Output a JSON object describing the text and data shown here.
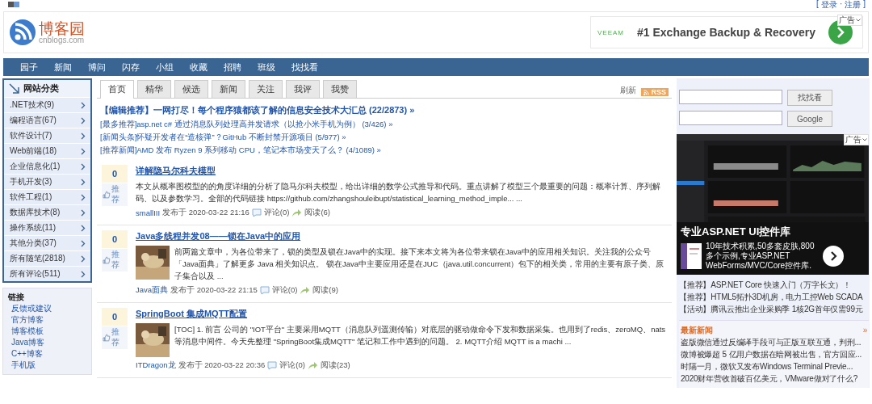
{
  "top_bar": {
    "open": "[",
    "links": [
      "登录",
      "注册"
    ],
    "separator": "·",
    "close": "]"
  },
  "header": {
    "logo": {
      "name": "博客园",
      "domain": "cnblogs.com"
    },
    "ad": {
      "brand": "VEEAM",
      "headline": "#1 Exchange Backup & Recovery",
      "tag": "广告"
    }
  },
  "nav": [
    "园子",
    "新闻",
    "博问",
    "闪存",
    "小组",
    "收藏",
    "招聘",
    "班级",
    "找找看"
  ],
  "sidebar": {
    "categories": {
      "title": "网站分类",
      "items": [
        ".NET技术(9)",
        "编程语言(67)",
        "软件设计(7)",
        "Web前端(18)",
        "企业信息化(1)",
        "手机开发(3)",
        "软件工程(1)",
        "数据库技术(8)",
        "操作系统(11)",
        "其他分类(37)",
        "所有随笔(2818)",
        "所有评论(511)"
      ]
    },
    "links": {
      "title": "链接",
      "items": [
        "反馈或建议",
        "官方博客",
        "博客模板",
        "Java博客",
        "C++博客",
        "手机版"
      ]
    }
  },
  "tabs": [
    {
      "label": "首页",
      "selected": true
    },
    {
      "label": "精华",
      "selected": false
    },
    {
      "label": "候选",
      "selected": false
    },
    {
      "label": "新闻",
      "selected": false
    },
    {
      "label": "关注",
      "selected": false
    },
    {
      "label": "我评",
      "selected": false
    },
    {
      "label": "我赞",
      "selected": false
    }
  ],
  "tab_actions": {
    "refresh": "刷新",
    "rss": "RSS"
  },
  "headlines": [
    {
      "kind": "featured",
      "label": "【编辑推荐】一网打尽！每个程序猿都该了解的信息安全技术大汇总",
      "count": "(22/2873)",
      "more": "»"
    },
    {
      "kind": "normal",
      "label": "[最多推荐]asp.net c# 通过消息队列处理高并发请求（以抢小米手机为例）",
      "count": "(3/426)",
      "more": "»"
    },
    {
      "kind": "normal",
      "label": "[新闻头条]怀疑开发者在“造核弹”？GitHub 不断封禁开源项目",
      "count": "(5/977)",
      "more": "»"
    },
    {
      "kind": "normal",
      "label": "[推荐新闻]AMD 发布 Ryzen 9 系列移动 CPU，笔记本市场变天了么？",
      "count": "(4/1089)",
      "more": "»"
    }
  ],
  "posts": [
    {
      "votes": "0",
      "vote_label": "推荐",
      "title": "详解隐马尔科夫模型",
      "thumbnail": false,
      "summary": "本文从概率图模型的的角度详细的分析了隐马尔科夫模型，给出详细的数学公式推导和代码。重点讲解了模型三个最重要的问题：概率计算、序列解码、以及参数学习。全部的代码链接 https://github.com/zhangshouleibupt/statistical_learning_method_imple... ...",
      "author": "smallIII",
      "published": "发布于 2020-03-22 21:16",
      "comments": "评论(0)",
      "reads": "阅读(6)"
    },
    {
      "votes": "0",
      "vote_label": "推荐",
      "title": "Java多线程并发08——锁在Java中的应用",
      "thumbnail": true,
      "summary": "前两篇文章中，为各位带来了，锁的类型及锁在Java中的实现。接下来本文将为各位带来锁在Java中的应用相关知识。关注我的公众号「Java面典」了解更多 Java 相关知识点。 锁在Java中主要应用还是在JUC（java.util.concurrent）包下的相关类，常用的主要有原子类、原子集合以及 ...",
      "author": "Java面典",
      "published": "发布于 2020-03-22 21:15",
      "comments": "评论(0)",
      "reads": "阅读(9)"
    },
    {
      "votes": "0",
      "vote_label": "推荐",
      "title": "SpringBoot 集成MQTT配置",
      "thumbnail": true,
      "summary": "[TOC] 1. 前言 公司的 \"IOT平台\" 主要采用MQTT（消息队列遥测传输）对底层的驱动做命令下发和数据采集。也用到了redis、zeroMQ、nats等消息中间件。今天先整理 \"SpringBoot集成MQTT\" 笔记和工作中遇到的问题。 2. MQTT介绍 MQTT is a machi ...",
      "author": "ITDragon龙",
      "published": "发布于 2020-03-22 20:36",
      "comments": "评论(0)",
      "reads": "阅读(23)"
    }
  ],
  "right": {
    "search": [
      {
        "button": "找找看"
      },
      {
        "button": "Google"
      }
    ],
    "ad": {
      "kind": "picture",
      "tag": "广告",
      "title": "专业ASP.NET UI控件库",
      "text": "10年技术积累,50多套皮肤,800多个示例,专业ASP.NET WebForms/MVC/Core控件库."
    },
    "promos": [
      "【推荐】ASP.NET Core 快速入门（万字长文）！",
      "【推荐】HTML5拓扑3D机房，电力工控Web SCADA",
      "【活动】腾讯云推出企业采购季 1核2G首年仅需99元"
    ],
    "news": {
      "title": "最新新闻",
      "more": "»",
      "items": [
        "盗版微信通过反编译手段可与正版互联互通，判刑...",
        "微博被爆超 5 亿用户数据在暗网被出售，官方回应...",
        "时隔一月，微软又发布Windows Terminal Previe...",
        "2020财年营收首破百亿美元，VMware做对了什么?"
      ]
    }
  }
}
